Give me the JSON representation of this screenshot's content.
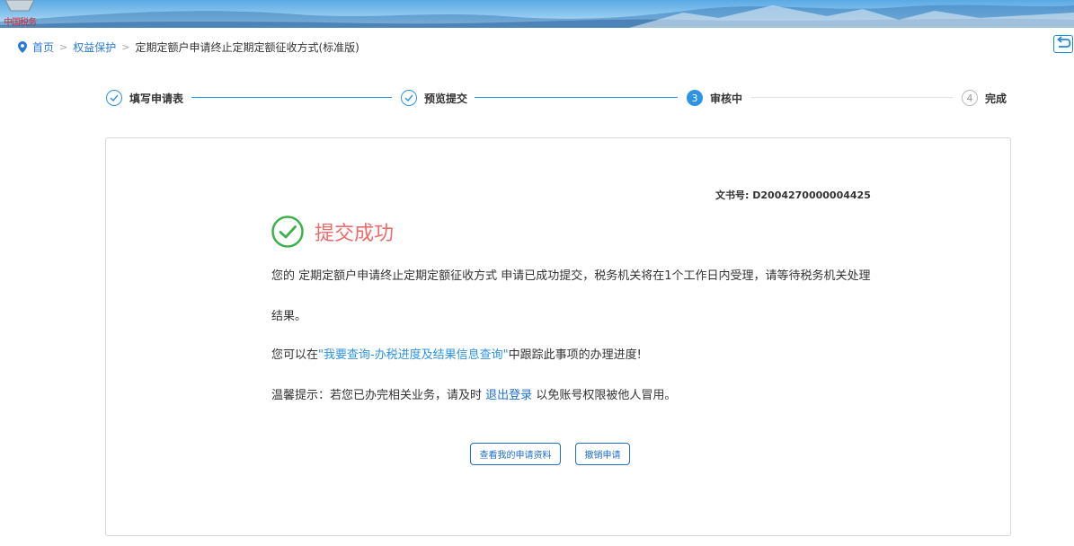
{
  "banner": {
    "logo_text": "中国税务"
  },
  "breadcrumb": {
    "items": [
      "首页",
      "权益保护"
    ],
    "separator": ">",
    "current": "定期定额户申请终止定期定额征收方式(标准版)"
  },
  "steps": [
    {
      "index": "1",
      "label": "填写申请表",
      "state": "done"
    },
    {
      "index": "2",
      "label": "预览提交",
      "state": "done"
    },
    {
      "index": "3",
      "label": "审核中",
      "state": "active"
    },
    {
      "index": "4",
      "label": "完成",
      "state": "todo"
    }
  ],
  "result": {
    "doc_label": "文书号:",
    "doc_number": "D2004270000004425",
    "title": "提交成功",
    "line1": "您的 定期定额户申请终止定期定额征收方式 申请已成功提交，税务机关将在1个工作日内受理，请等待税务机关处理",
    "line2": "结果。",
    "line3_pre": "您可以在",
    "line3_link": "\"我要查询-办税进度及结果信息查询\"",
    "line3_post": "中跟踪此事项的办理进度!",
    "line4_pre": "温馨提示：若您已办完相关业务，请及时",
    "line4_link": "退出登录",
    "line4_post": "以免账号权限被他人冒用。"
  },
  "buttons": {
    "view_label": "查看我的申请资料",
    "revoke_label": "撤销申请"
  },
  "colors": {
    "primary": "#2d93e2",
    "link": "#1f6fd1",
    "success_title": "#ee6b6b",
    "success_icon": "#3bb24a"
  }
}
